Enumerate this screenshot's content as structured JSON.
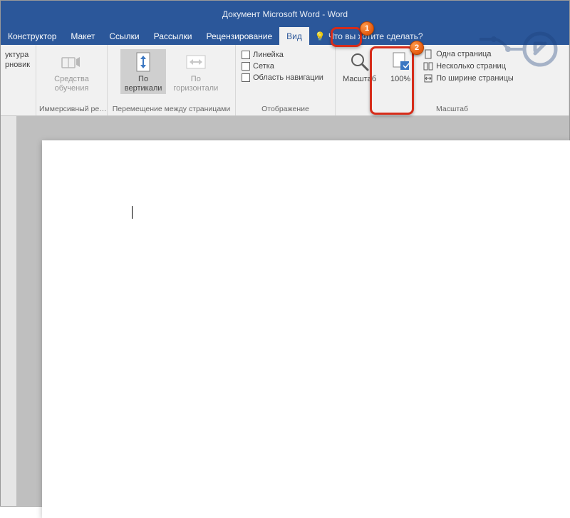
{
  "title": "Документ Microsoft Word  -  Word",
  "tabs": {
    "konstruktor": "Конструктор",
    "maket": "Макет",
    "ssylki": "Ссылки",
    "rassylki": "Рассылки",
    "retsenz": "Рецензирование",
    "vid": "Вид"
  },
  "tellme": "Что вы хотите сделать?",
  "group_views": {
    "item1": "уктура",
    "item2": "рновик",
    "label": ""
  },
  "group_immersive": {
    "btn": "Средства\nобучения",
    "label": "Иммерсивный ре…"
  },
  "group_pagemove": {
    "vertical": "По\nвертикали",
    "horizontal": "По\nгоризонтали",
    "label": "Перемещение между страницами"
  },
  "group_show": {
    "ruler": "Линейка",
    "grid": "Сетка",
    "navpane": "Область навигации",
    "label": "Отображение"
  },
  "group_zoom": {
    "zoom": "Масштаб",
    "hundred": "100%",
    "onepage": "Одна страница",
    "multipage": "Несколько страниц",
    "pagewidth": "По ширине страницы",
    "label": "Масштаб"
  },
  "steps": {
    "one": "1",
    "two": "2"
  }
}
